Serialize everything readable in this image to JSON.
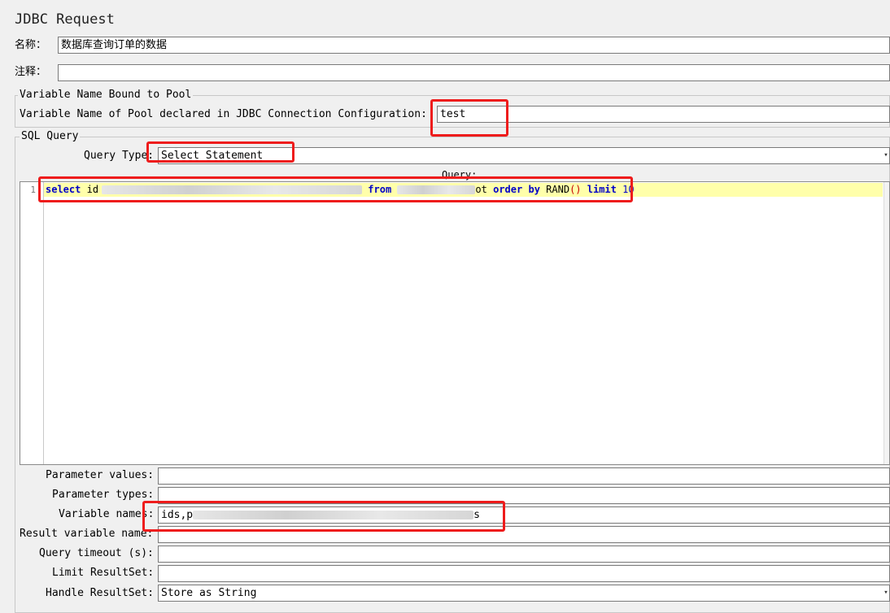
{
  "panel": {
    "title": "JDBC Request"
  },
  "name_field": {
    "label": "名称：",
    "value": "数据库查询订单的数据"
  },
  "comment_field": {
    "label": "注释：",
    "value": ""
  },
  "pool_group": {
    "title": "Variable Name Bound to Pool",
    "pool_label": "Variable Name of Pool declared in JDBC Connection Configuration:",
    "pool_value": "test"
  },
  "sql_group": {
    "title": "SQL Query",
    "query_type_label": "Query Type:",
    "query_type_value": "Select Statement",
    "query_label": "Query:",
    "line_number": "1",
    "code": {
      "select_kw": "select",
      "col_start": "id",
      "from_kw": "from",
      "table_end": "ot",
      "order_kw": "order",
      "by_kw": "by",
      "fn": "RAND",
      "parens": "()",
      "limit_kw": "limit",
      "limit_num": "10"
    }
  },
  "params": {
    "parameter_values_label": "Parameter values:",
    "parameter_values": "",
    "parameter_types_label": "Parameter types:",
    "parameter_types": "",
    "variable_names_label": "Variable names:",
    "variable_names_start": "ids,p",
    "variable_names_end": "s",
    "result_var_label": "Result variable name:",
    "result_var": "",
    "query_timeout_label": "Query timeout (s):",
    "query_timeout": "",
    "limit_resultset_label": "Limit ResultSet:",
    "limit_resultset": "",
    "handle_resultset_label": "Handle ResultSet:",
    "handle_resultset": "Store as String"
  },
  "annotation_color": "#ee1c1c"
}
